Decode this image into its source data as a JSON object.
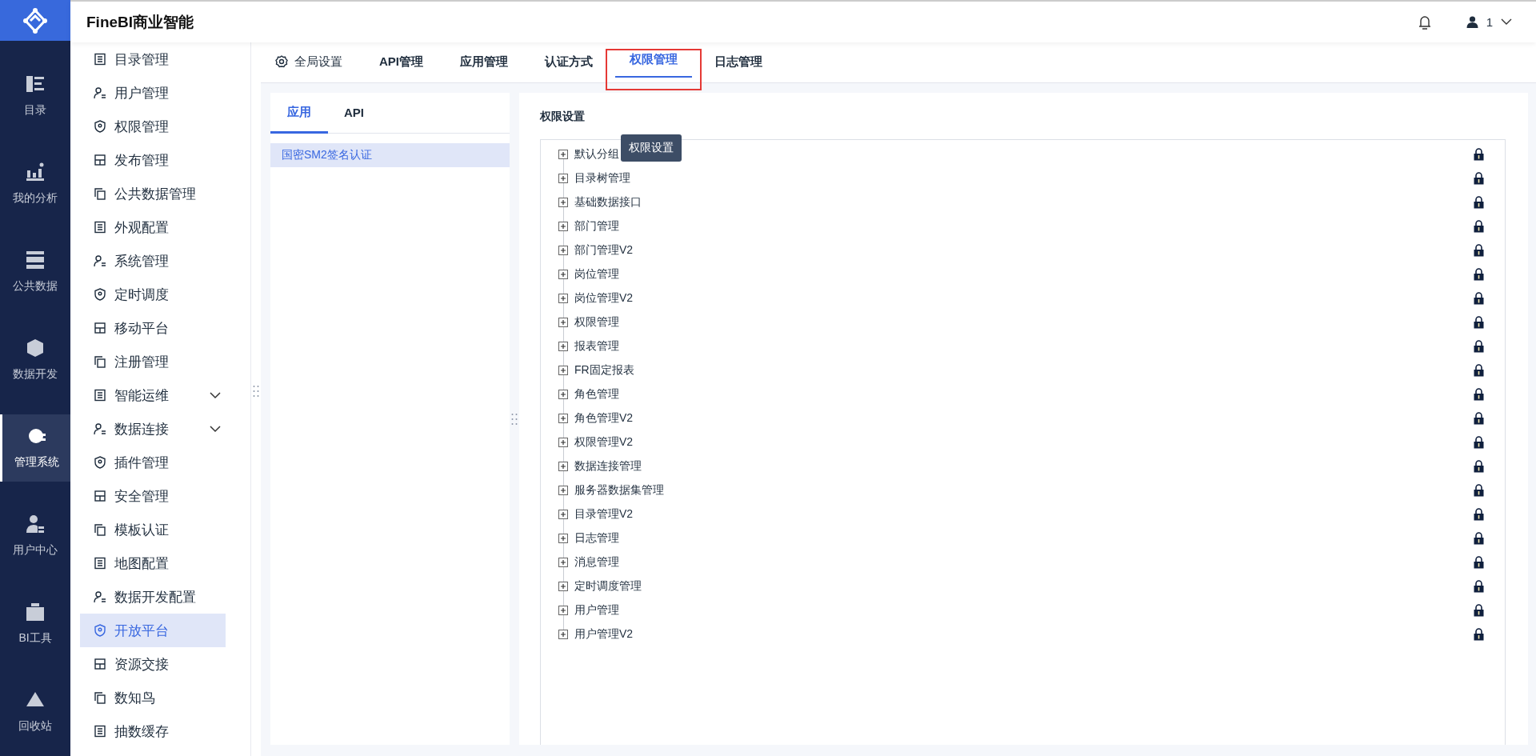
{
  "brand": {
    "title": "FineBI商业智能"
  },
  "header": {
    "user": "1"
  },
  "rail": [
    {
      "label": "目录",
      "selected": false
    },
    {
      "label": "我的分析",
      "selected": false
    },
    {
      "label": "公共数据",
      "selected": false
    },
    {
      "label": "数据开发",
      "selected": false
    },
    {
      "label": "管理系统",
      "selected": true
    },
    {
      "label": "用户中心",
      "selected": false
    },
    {
      "label": "BI工具",
      "selected": false
    },
    {
      "label": "回收站",
      "selected": false
    }
  ],
  "menu": [
    {
      "label": "目录管理",
      "selected": false,
      "expandable": false
    },
    {
      "label": "用户管理",
      "selected": false,
      "expandable": false
    },
    {
      "label": "权限管理",
      "selected": false,
      "expandable": false
    },
    {
      "label": "发布管理",
      "selected": false,
      "expandable": false
    },
    {
      "label": "公共数据管理",
      "selected": false,
      "expandable": false
    },
    {
      "label": "外观配置",
      "selected": false,
      "expandable": false
    },
    {
      "label": "系统管理",
      "selected": false,
      "expandable": false
    },
    {
      "label": "定时调度",
      "selected": false,
      "expandable": false
    },
    {
      "label": "移动平台",
      "selected": false,
      "expandable": false
    },
    {
      "label": "注册管理",
      "selected": false,
      "expandable": false
    },
    {
      "label": "智能运维",
      "selected": false,
      "expandable": true
    },
    {
      "label": "数据连接",
      "selected": false,
      "expandable": true
    },
    {
      "label": "插件管理",
      "selected": false,
      "expandable": false
    },
    {
      "label": "安全管理",
      "selected": false,
      "expandable": false
    },
    {
      "label": "模板认证",
      "selected": false,
      "expandable": false
    },
    {
      "label": "地图配置",
      "selected": false,
      "expandable": false
    },
    {
      "label": "数据开发配置",
      "selected": false,
      "expandable": false
    },
    {
      "label": "开放平台",
      "selected": true,
      "expandable": false
    },
    {
      "label": "资源交接",
      "selected": false,
      "expandable": false
    },
    {
      "label": "数知鸟",
      "selected": false,
      "expandable": false
    },
    {
      "label": "抽数缓存",
      "selected": false,
      "expandable": false
    }
  ],
  "tabs": [
    {
      "label": "全局设置",
      "selected": false,
      "highlighted": false
    },
    {
      "label": "API管理",
      "selected": false,
      "highlighted": false
    },
    {
      "label": "应用管理",
      "selected": false,
      "highlighted": false
    },
    {
      "label": "认证方式",
      "selected": false,
      "highlighted": false
    },
    {
      "label": "权限管理",
      "selected": true,
      "highlighted": true
    },
    {
      "label": "日志管理",
      "selected": false,
      "highlighted": false
    }
  ],
  "subtabs": [
    {
      "label": "应用",
      "selected": true
    },
    {
      "label": "API",
      "selected": false
    }
  ],
  "apps": [
    {
      "label": "国密SM2签名认证",
      "selected": true
    }
  ],
  "permissions": {
    "title": "权限设置",
    "tooltip": "权限设置",
    "items": [
      {
        "label": "默认分组",
        "locked": true
      },
      {
        "label": "目录树管理",
        "locked": true
      },
      {
        "label": "基础数据接口",
        "locked": true
      },
      {
        "label": "部门管理",
        "locked": true
      },
      {
        "label": "部门管理V2",
        "locked": true
      },
      {
        "label": "岗位管理",
        "locked": true
      },
      {
        "label": "岗位管理V2",
        "locked": true
      },
      {
        "label": "权限管理",
        "locked": true
      },
      {
        "label": "报表管理",
        "locked": true
      },
      {
        "label": "FR固定报表",
        "locked": true
      },
      {
        "label": "角色管理",
        "locked": true
      },
      {
        "label": "角色管理V2",
        "locked": true
      },
      {
        "label": "权限管理V2",
        "locked": true
      },
      {
        "label": "数据连接管理",
        "locked": true
      },
      {
        "label": "服务器数据集管理",
        "locked": true
      },
      {
        "label": "目录管理V2",
        "locked": true
      },
      {
        "label": "日志管理",
        "locked": true
      },
      {
        "label": "消息管理",
        "locked": true
      },
      {
        "label": "定时调度管理",
        "locked": true
      },
      {
        "label": "用户管理",
        "locked": true
      },
      {
        "label": "用户管理V2",
        "locked": true
      }
    ]
  }
}
